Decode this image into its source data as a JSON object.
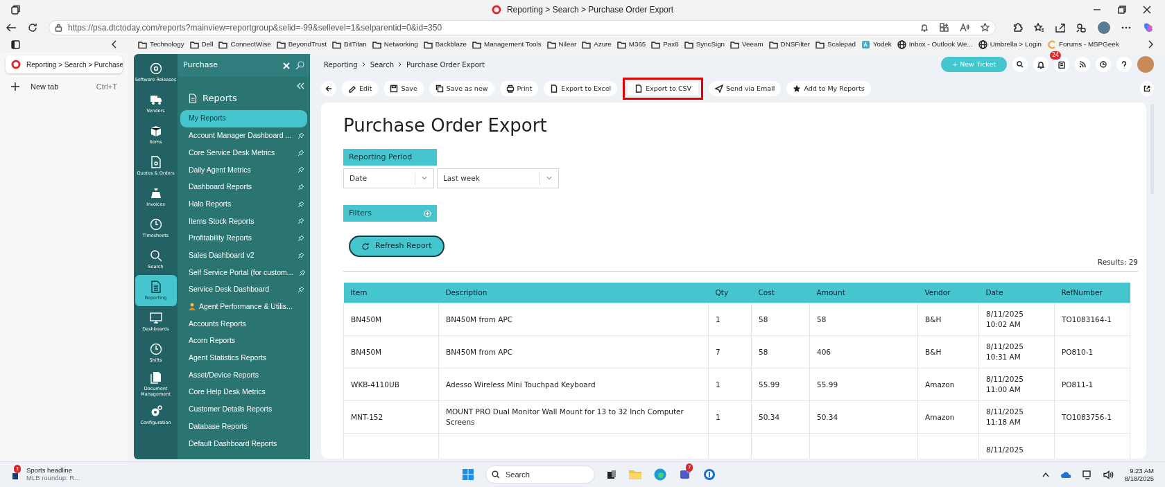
{
  "browser": {
    "window_title": "Reporting > Search > Purchase Order Export",
    "url": "https://psa.dtctoday.com/reports?mainview=reportgroup&selid=-99&sellevel=1&selparentid=0&id=350",
    "bookmarks": [
      {
        "label": "Technology",
        "kind": "folder"
      },
      {
        "label": "Dell",
        "kind": "folder"
      },
      {
        "label": "ConnectWise",
        "kind": "folder"
      },
      {
        "label": "BeyondTrust",
        "kind": "folder"
      },
      {
        "label": "BitTitan",
        "kind": "folder"
      },
      {
        "label": "Networking",
        "kind": "folder"
      },
      {
        "label": "Backblaze",
        "kind": "folder"
      },
      {
        "label": "Management Tools",
        "kind": "folder"
      },
      {
        "label": "Nilear",
        "kind": "folder"
      },
      {
        "label": "Azure",
        "kind": "folder"
      },
      {
        "label": "M365",
        "kind": "folder"
      },
      {
        "label": "Pax8",
        "kind": "folder"
      },
      {
        "label": "SyncSign",
        "kind": "folder"
      },
      {
        "label": "Veeam",
        "kind": "folder"
      },
      {
        "label": "DNSFilter",
        "kind": "folder"
      },
      {
        "label": "Scalepad",
        "kind": "folder"
      },
      {
        "label": "Yodek",
        "kind": "site"
      },
      {
        "label": "Inbox - Outlook We...",
        "kind": "globe"
      },
      {
        "label": "Umbrella > Login",
        "kind": "globe"
      },
      {
        "label": "Forums - MSPGeek",
        "kind": "forum"
      }
    ],
    "tabs": [
      {
        "title": "Reporting > Search > Purchase",
        "selected": true
      }
    ],
    "new_tab": {
      "label": "New tab",
      "shortcut": "Ctrl+T"
    }
  },
  "app": {
    "nav_rail": [
      {
        "label": "Software Releases",
        "selected": false
      },
      {
        "label": "Vendors",
        "selected": false
      },
      {
        "label": "Items",
        "selected": false
      },
      {
        "label": "Quotes & Orders",
        "selected": false
      },
      {
        "label": "Invoices",
        "selected": false
      },
      {
        "label": "Timesheets",
        "selected": false
      },
      {
        "label": "Search",
        "selected": false
      },
      {
        "label": "Reporting",
        "selected": true
      },
      {
        "label": "Dashboards",
        "selected": false
      },
      {
        "label": "Shifts",
        "selected": false
      },
      {
        "label": "Document Management",
        "selected": false
      },
      {
        "label": "Configuration",
        "selected": false
      }
    ],
    "sidebar": {
      "search_title": "Purchase",
      "heading": "Reports",
      "items": [
        {
          "label": "My Reports",
          "selected": true,
          "pinned": false
        },
        {
          "label": "Account Manager Dashboard ...",
          "selected": false,
          "pinned": true
        },
        {
          "label": "Core Service Desk Metrics",
          "selected": false,
          "pinned": true
        },
        {
          "label": "Daily Agent Metrics",
          "selected": false,
          "pinned": true
        },
        {
          "label": "Dashboard Reports",
          "selected": false,
          "pinned": true
        },
        {
          "label": "Halo Reports",
          "selected": false,
          "pinned": true
        },
        {
          "label": "Items Stock Reports",
          "selected": false,
          "pinned": true
        },
        {
          "label": "Profitability Reports",
          "selected": false,
          "pinned": true
        },
        {
          "label": "Sales Dashboard v2",
          "selected": false,
          "pinned": true
        },
        {
          "label": "Self Service Portal (for custom...",
          "selected": false,
          "pinned": true
        },
        {
          "label": "Service Desk Dashboard",
          "selected": false,
          "pinned": true
        },
        {
          "label": "Agent Performance & Utilis...",
          "selected": false,
          "pinned": false,
          "kind": "emoji"
        },
        {
          "label": "Accounts Reports",
          "selected": false,
          "pinned": false
        },
        {
          "label": "Acorn Reports",
          "selected": false,
          "pinned": false
        },
        {
          "label": "Agent Statistics Reports",
          "selected": false,
          "pinned": false
        },
        {
          "label": "Asset/Device Reports",
          "selected": false,
          "pinned": false
        },
        {
          "label": "Core Help Desk Metrics",
          "selected": false,
          "pinned": false
        },
        {
          "label": "Customer Details Reports",
          "selected": false,
          "pinned": false
        },
        {
          "label": "Database Reports",
          "selected": false,
          "pinned": false
        },
        {
          "label": "Default Dashboard Reports",
          "selected": false,
          "pinned": false
        }
      ]
    },
    "breadcrumb": [
      "Reporting",
      "Search",
      "Purchase Order Export"
    ],
    "new_ticket": "+ New Ticket",
    "notification_badge": "24",
    "toolbar": [
      {
        "label": "Edit",
        "highlighted": false
      },
      {
        "label": "Save",
        "highlighted": false
      },
      {
        "label": "Save as new",
        "highlighted": false
      },
      {
        "label": "Print",
        "highlighted": false
      },
      {
        "label": "Export to Excel",
        "highlighted": false
      },
      {
        "label": "Export to CSV",
        "highlighted": true
      },
      {
        "label": "Send via Email",
        "highlighted": false
      },
      {
        "label": "Add to My Reports",
        "highlighted": false
      }
    ],
    "report": {
      "title": "Purchase Order Export",
      "reporting_period": {
        "label": "Reporting Period",
        "fields": [
          {
            "value": "Date"
          },
          {
            "value": "Last week"
          }
        ]
      },
      "filters_label": "Filters",
      "refresh_button": "Refresh Report",
      "results": "Results: 29",
      "table": {
        "columns": [
          "Item",
          "Description",
          "Qty",
          "Cost",
          "Amount",
          "Vendor",
          "Date",
          "RefNumber"
        ],
        "rows": [
          [
            "BN450M",
            "BN450M from APC",
            "1",
            "58",
            "58",
            "B&H",
            "8/11/2025 10:02 AM",
            "TO1083164-1"
          ],
          [
            "BN450M",
            "BN450M from APC",
            "7",
            "58",
            "406",
            "B&H",
            "8/11/2025 10:31 AM",
            "PO810-1"
          ],
          [
            "WKB-4110UB",
            "Adesso Wireless Mini Touchpad Keyboard",
            "1",
            "55.99",
            "55.99",
            "Amazon",
            "8/11/2025 11:00 AM",
            "PO811-1"
          ],
          [
            "MNT-152",
            "MOUNT PRO Dual Monitor Wall Mount for 13 to 32 Inch Computer Screens",
            "1",
            "50.34",
            "50.34",
            "Amazon",
            "8/11/2025 11:18 AM",
            "TO1083756-1"
          ],
          [
            null,
            null,
            null,
            null,
            null,
            null,
            "8/11/2025",
            null
          ]
        ]
      }
    }
  },
  "taskbar": {
    "news": {
      "badge": "1",
      "title": "Sports headline",
      "subtitle": "MLB roundup: R..."
    },
    "search_placeholder": "Search",
    "teams_badge": "7",
    "time": "9:23 AM",
    "date": "8/18/2025"
  }
}
